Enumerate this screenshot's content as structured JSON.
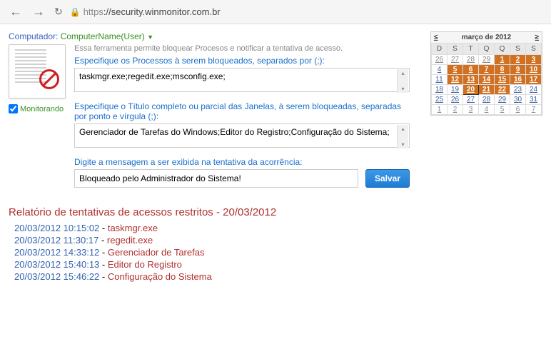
{
  "browser": {
    "url_prefix": "https",
    "url_rest": "://security.winmonitor.com.br"
  },
  "header": {
    "label": "Computador:",
    "computer": "ComputerName(User)",
    "dropdown_glyph": "▼"
  },
  "monitor_label": "Monitorando",
  "intro": "Essa ferramenta permite bloquear Procesos e notificar a tentativa de acesso.",
  "field1_label": "Especifique os Processos à serem bloqueados, separados por (;):",
  "field1_value": "taskmgr.exe;regedit.exe;msconfig.exe;",
  "field2_label": "Especifique o Título completo ou parcial das Janelas, à serem bloqueadas, separadas por ponto e vírgula (;):",
  "field2_value": "Gerenciador de Tarefas do Windows;Editor do Registro;Configuração do Sistema;",
  "field3_label": "Digite a mensagem a ser exibida na tentativa da acorrência:",
  "field3_value": "Bloqueado pelo Administrador do Sistema!",
  "save_label": "Salvar",
  "calendar": {
    "title": "março de 2012",
    "days": [
      "D",
      "S",
      "T",
      "Q",
      "Q",
      "S",
      "S"
    ],
    "prev": "≤",
    "next": "≥",
    "rows": [
      [
        {
          "d": "26",
          "m": true
        },
        {
          "d": "27",
          "m": true
        },
        {
          "d": "28",
          "m": true
        },
        {
          "d": "29",
          "m": true
        },
        {
          "d": "1",
          "hl": true
        },
        {
          "d": "2",
          "hl": true
        },
        {
          "d": "3",
          "hl": true
        }
      ],
      [
        {
          "d": "4"
        },
        {
          "d": "5",
          "hl": true
        },
        {
          "d": "6",
          "hl": true
        },
        {
          "d": "7",
          "hl": true
        },
        {
          "d": "8",
          "hl": true
        },
        {
          "d": "9",
          "hl": true
        },
        {
          "d": "10",
          "hl": true
        }
      ],
      [
        {
          "d": "11"
        },
        {
          "d": "12",
          "hl": true
        },
        {
          "d": "13",
          "hl": true
        },
        {
          "d": "14",
          "hl": true
        },
        {
          "d": "15",
          "hl": true
        },
        {
          "d": "16",
          "hl": true
        },
        {
          "d": "17",
          "hl": true
        }
      ],
      [
        {
          "d": "18"
        },
        {
          "d": "19"
        },
        {
          "d": "20",
          "hl": true,
          "sel": true
        },
        {
          "d": "21",
          "hl": true
        },
        {
          "d": "22",
          "hl": true
        },
        {
          "d": "23"
        },
        {
          "d": "24"
        }
      ],
      [
        {
          "d": "25"
        },
        {
          "d": "26"
        },
        {
          "d": "27"
        },
        {
          "d": "28"
        },
        {
          "d": "29"
        },
        {
          "d": "30"
        },
        {
          "d": "31"
        }
      ],
      [
        {
          "d": "1",
          "m": true
        },
        {
          "d": "2",
          "m": true
        },
        {
          "d": "3",
          "m": true
        },
        {
          "d": "4",
          "m": true
        },
        {
          "d": "5",
          "m": true
        },
        {
          "d": "6",
          "m": true
        },
        {
          "d": "7",
          "m": true
        }
      ]
    ]
  },
  "report": {
    "title": "Relatório de tentativas de acessos restritos - 20/03/2012",
    "lines": [
      {
        "ts": "20/03/2012 10:15:02",
        "name": "taskmgr.exe"
      },
      {
        "ts": "20/03/2012 11:30:17",
        "name": "regedit.exe"
      },
      {
        "ts": "20/03/2012 14:33:12",
        "name": "Gerenciador de Tarefas"
      },
      {
        "ts": "20/03/2012 15:40:13",
        "name": "Editor do Registro"
      },
      {
        "ts": "20/03/2012 15:46:22",
        "name": "Configuração do Sistema"
      }
    ]
  }
}
